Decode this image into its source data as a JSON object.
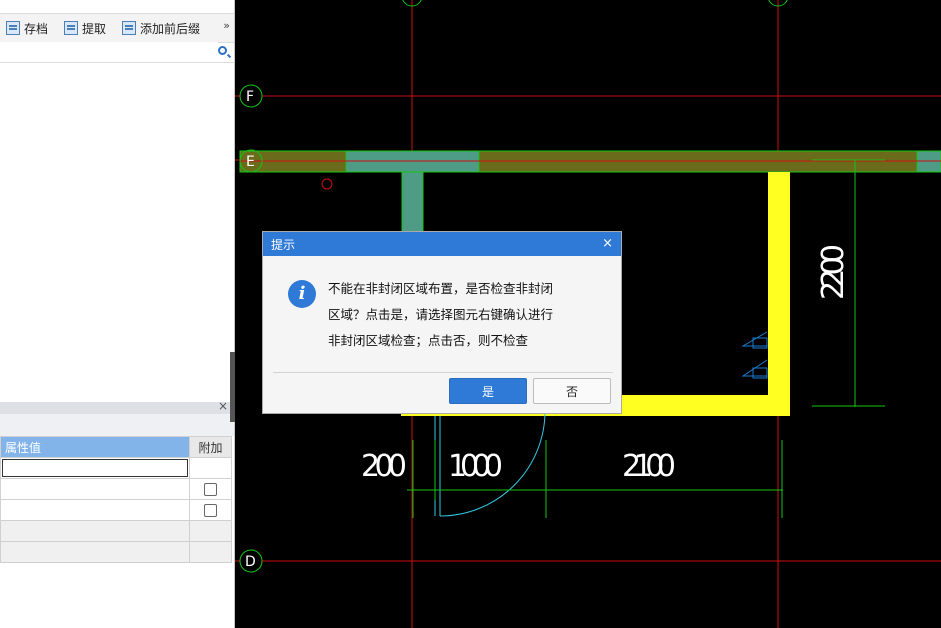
{
  "toolbar": {
    "save_label": "存档",
    "extract_label": "提取",
    "prefix_label": "添加前后缀",
    "more_label": "»"
  },
  "search": {
    "value": "",
    "placeholder": ""
  },
  "properties": {
    "close_label": "×",
    "header_value": "属性值",
    "header_extra": "附加"
  },
  "cad": {
    "axes": {
      "F": "F",
      "E": "E",
      "D": "D"
    },
    "dimensions": {
      "d200": "200",
      "d1000": "1000",
      "d2100": "2100",
      "d2200": "2200"
    },
    "colors": {
      "wall": "#4f9c86",
      "yellow": "#ffff22",
      "axis": "#cc1010",
      "dim": "#14c414"
    }
  },
  "dialog": {
    "title": "提示",
    "close_label": "×",
    "message_line1": "不能在非封闭区域布置，是否检查非封闭",
    "message_line2": "区域？点击是，请选择图元右键确认进行",
    "message_line3": "非封闭区域检查；点击否，则不检查",
    "yes_label": "是",
    "no_label": "否",
    "accent": "#2f7ad7"
  }
}
